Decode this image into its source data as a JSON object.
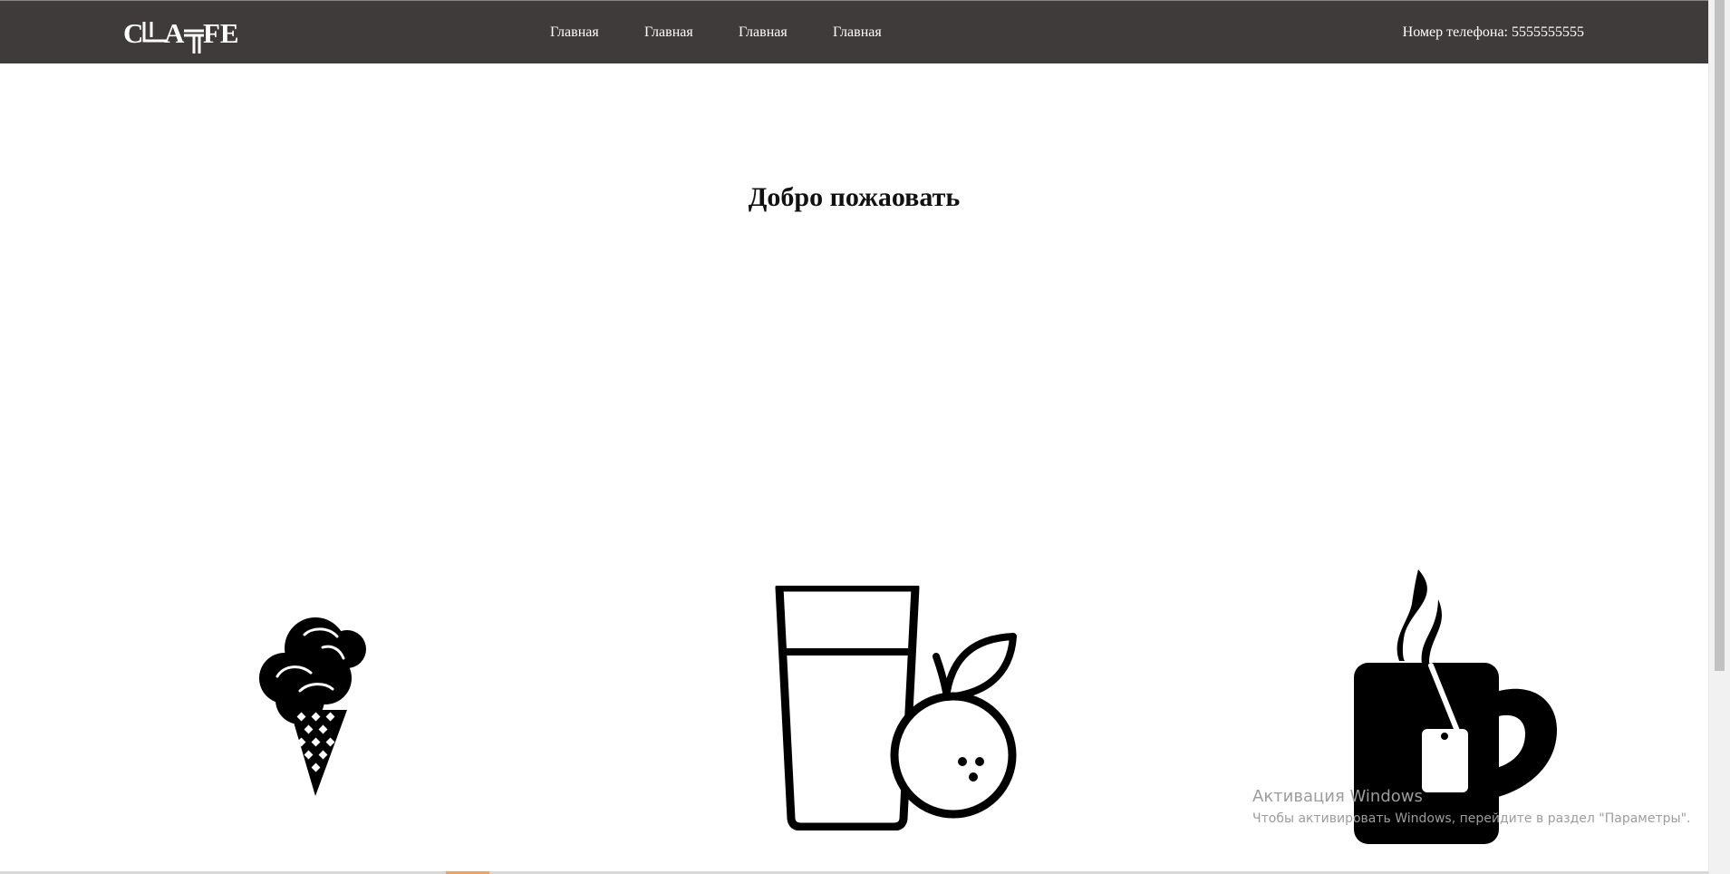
{
  "header": {
    "logo_text": "CAFE",
    "nav": [
      {
        "label": "Главная"
      },
      {
        "label": "Главная"
      },
      {
        "label": "Главная"
      },
      {
        "label": "Главная"
      }
    ],
    "phone": "Номер телефона: 5555555555"
  },
  "main": {
    "heading": "Добро пожаовать",
    "icons": [
      "ice-cream-icon",
      "juice-glass-orange-icon",
      "tea-mug-icon"
    ]
  },
  "watermark": {
    "title": "Активация Windows",
    "subtitle": "Чтобы активировать Windows, перейдите в раздел \"Параметры\"."
  },
  "colors": {
    "header_bg": "#403b3b",
    "text_white": "#ffffff",
    "icon_black": "#000000"
  }
}
